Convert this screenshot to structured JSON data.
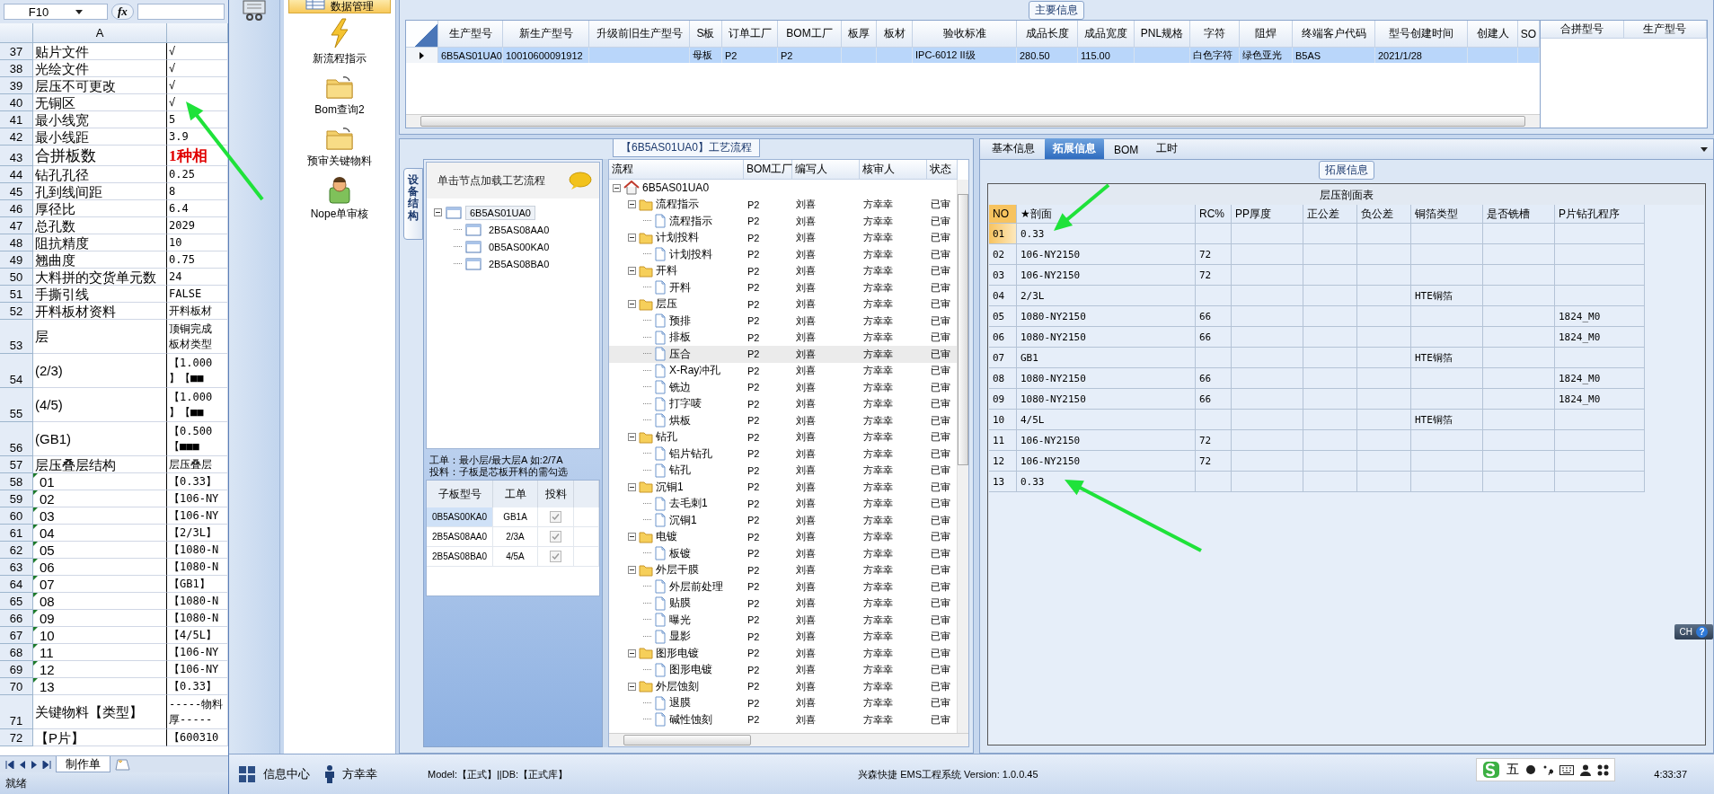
{
  "spreadsheet": {
    "name_box": "F10",
    "formula_label": "fx",
    "column_header": "A",
    "rows": [
      {
        "num": "37",
        "a": "贴片文件",
        "b": [
          "√"
        ]
      },
      {
        "num": "38",
        "a": "光绘文件",
        "b": [
          "√"
        ]
      },
      {
        "num": "39",
        "a": "层压不可更改",
        "b": [
          "√"
        ]
      },
      {
        "num": "40",
        "a": "无铜区",
        "b": [
          "√"
        ],
        "marked": true
      },
      {
        "num": "41",
        "a": "最小线宽",
        "b": [
          "5"
        ]
      },
      {
        "num": "42",
        "a": "最小线距",
        "b": [
          "3.9"
        ]
      },
      {
        "num": "43",
        "a": "合拼板数",
        "b": [
          "1种相"
        ],
        "kind": "emphasis"
      },
      {
        "num": "44",
        "a": "钻孔孔径",
        "b": [
          "0.25"
        ]
      },
      {
        "num": "45",
        "a": "孔到线间距",
        "b": [
          "8"
        ]
      },
      {
        "num": "46",
        "a": "厚径比",
        "b": [
          "6.4"
        ]
      },
      {
        "num": "47",
        "a": "总孔数",
        "b": [
          "2029"
        ]
      },
      {
        "num": "48",
        "a": "阻抗精度",
        "b": [
          "10"
        ]
      },
      {
        "num": "49",
        "a": "翘曲度",
        "b": [
          "0.75"
        ]
      },
      {
        "num": "50",
        "a": "大料拼的交货单元数",
        "b": [
          "24"
        ]
      },
      {
        "num": "51",
        "a": "手撕引线",
        "b": [
          "FALSE"
        ]
      },
      {
        "num": "52",
        "a": "开料板材资料",
        "b": [
          "开料板材"
        ]
      },
      {
        "num": "53",
        "a": "层",
        "b": [
          "顶铜完成",
          "板材类型"
        ]
      },
      {
        "num": "54",
        "a": "(2/3)",
        "b": [
          "【1.000",
          "】【■■"
        ]
      },
      {
        "num": "55",
        "a": "(4/5)",
        "b": [
          "【1.000",
          "】【■■"
        ]
      },
      {
        "num": "56",
        "a": "(GB1)",
        "b": [
          "【0.500",
          "【■■■"
        ]
      },
      {
        "num": "57",
        "a": "层压叠层结构",
        "b": [
          "层压叠层"
        ]
      },
      {
        "num": "58",
        "a": "01",
        "b": [
          "【0.33】"
        ],
        "flag": true
      },
      {
        "num": "59",
        "a": "02",
        "b": [
          "【106-NY"
        ],
        "flag": true
      },
      {
        "num": "60",
        "a": "03",
        "b": [
          "【106-NY"
        ],
        "flag": true
      },
      {
        "num": "61",
        "a": "04",
        "b": [
          "【2/3L】"
        ],
        "flag": true
      },
      {
        "num": "62",
        "a": "05",
        "b": [
          "【1080-N"
        ],
        "flag": true
      },
      {
        "num": "63",
        "a": "06",
        "b": [
          "【1080-N"
        ],
        "flag": true
      },
      {
        "num": "64",
        "a": "07",
        "b": [
          "【GB1】"
        ],
        "flag": true
      },
      {
        "num": "65",
        "a": "08",
        "b": [
          "【1080-N"
        ],
        "flag": true
      },
      {
        "num": "66",
        "a": "09",
        "b": [
          "【1080-N"
        ],
        "flag": true
      },
      {
        "num": "67",
        "a": "10",
        "b": [
          "【4/5L】"
        ],
        "flag": true
      },
      {
        "num": "68",
        "a": "11",
        "b": [
          "【106-NY"
        ],
        "flag": true
      },
      {
        "num": "69",
        "a": "12",
        "b": [
          "【106-NY"
        ],
        "flag": true
      },
      {
        "num": "70",
        "a": "13",
        "b": [
          "【0.33】"
        ],
        "flag": true
      },
      {
        "num": "71",
        "a": "关键物料【类型】",
        "b": [
          "-----物料",
          "厚-----"
        ]
      },
      {
        "num": "72",
        "a": "【P片】",
        "b": [
          "【600310"
        ]
      }
    ],
    "sheet_tabs": [
      {
        "label": "制作单",
        "selected": true
      }
    ],
    "status": "就绪"
  },
  "nav": {
    "items": [
      {
        "label": "数据管理",
        "kind": "table",
        "selected": true
      },
      {
        "label": "新流程指示",
        "kind": "lightning",
        "selected": false
      },
      {
        "label": "Bom查询2",
        "kind": "folder",
        "selected": false
      },
      {
        "label": "预审关键物料",
        "kind": "folder",
        "selected": false
      },
      {
        "label": "Nope单审核",
        "kind": "person",
        "selected": false
      }
    ]
  },
  "main_info": {
    "title": "主要信息",
    "columns": [
      "生产型号",
      "新生产型号",
      "升级前旧生产型号",
      "S板",
      "订单工厂",
      "BOM工厂",
      "板厚",
      "板材",
      "验收标准",
      "成品长度",
      "成品宽度",
      "PNL规格",
      "字符",
      "阻焊",
      "终端客户代码",
      "型号创建时间",
      "创建人",
      "SO"
    ],
    "rows": [
      {
        "current": true,
        "cells": [
          "6B5AS01UA0",
          "10010600091912",
          null,
          "母板",
          "P2",
          "P2",
          null,
          null,
          "IPC-6012 II级",
          "280.50",
          "115.00",
          null,
          "白色字符",
          "绿色亚光",
          "B5AS",
          "2021/1/28",
          null,
          null
        ]
      }
    ],
    "side_columns": [
      "合拼型号",
      "生产型号"
    ]
  },
  "process": {
    "title": "【6B5AS01UA0】工艺流程",
    "side_tab": "设备结构",
    "hint": "单击节点加载工艺流程",
    "structure_tree": [
      {
        "label": "6B5AS01UA0",
        "expanded": true,
        "selected": true,
        "children": [
          {
            "label": "2B5AS08AA0",
            "selected": false
          },
          {
            "label": "0B5AS00KA0",
            "selected": false
          },
          {
            "label": "2B5AS08BA0",
            "selected": false
          }
        ]
      }
    ],
    "notes": [
      "工单：最小层/最大层A 如:2/7A",
      "投料：子板是芯板开料的需勾选"
    ],
    "sub_boards": {
      "columns": [
        "子板型号",
        "工单",
        "投料"
      ],
      "rows": [
        {
          "cells": [
            "0B5AS00KA0",
            "GB1A"
          ],
          "checked": true,
          "selected": true
        },
        {
          "cells": [
            "2B5AS08AA0",
            "2/3A"
          ],
          "checked": true,
          "selected": false
        },
        {
          "cells": [
            "2B5AS08BA0",
            "4/5A"
          ],
          "checked": true,
          "selected": false
        }
      ]
    },
    "flow": {
      "columns": [
        "流程",
        "BOM工厂",
        "编写人",
        "核审人",
        "状态"
      ],
      "tree": [
        {
          "label": "6B5AS01UA0",
          "kind": "home",
          "expanded": true,
          "selected": false,
          "children": [
            {
              "label": "流程指示",
              "kind": "folder",
              "expanded": true,
              "selected": false,
              "cells": [
                "P2",
                "刘喜",
                "方幸幸",
                "已审"
              ],
              "children": [
                {
                  "label": "流程指示",
                  "kind": "file",
                  "selected": false,
                  "cells": [
                    "P2",
                    "刘喜",
                    "方幸幸",
                    "已审"
                  ]
                }
              ]
            },
            {
              "label": "计划投料",
              "kind": "folder",
              "expanded": true,
              "selected": false,
              "cells": [
                "P2",
                "刘喜",
                "方幸幸",
                "已审"
              ],
              "children": [
                {
                  "label": "计划投料",
                  "kind": "file",
                  "selected": false,
                  "cells": [
                    "P2",
                    "刘喜",
                    "方幸幸",
                    "已审"
                  ]
                }
              ]
            },
            {
              "label": "开料",
              "kind": "folder",
              "expanded": true,
              "selected": false,
              "cells": [
                "P2",
                "刘喜",
                "方幸幸",
                "已审"
              ],
              "children": [
                {
                  "label": "开料",
                  "kind": "file",
                  "selected": false,
                  "cells": [
                    "P2",
                    "刘喜",
                    "方幸幸",
                    "已审"
                  ]
                }
              ]
            },
            {
              "label": "层压",
              "kind": "folder",
              "expanded": true,
              "selected": false,
              "cells": [
                "P2",
                "刘喜",
                "方幸幸",
                "已审"
              ],
              "children": [
                {
                  "label": "预排",
                  "kind": "file",
                  "selected": false,
                  "cells": [
                    "P2",
                    "刘喜",
                    "方幸幸",
                    "已审"
                  ]
                },
                {
                  "label": "排板",
                  "kind": "file",
                  "selected": false,
                  "cells": [
                    "P2",
                    "刘喜",
                    "方幸幸",
                    "已审"
                  ]
                },
                {
                  "label": "压合",
                  "kind": "file",
                  "selected": true,
                  "cells": [
                    "P2",
                    "刘喜",
                    "方幸幸",
                    "已审"
                  ]
                },
                {
                  "label": "X-Ray冲孔",
                  "kind": "file",
                  "selected": false,
                  "cells": [
                    "P2",
                    "刘喜",
                    "方幸幸",
                    "已审"
                  ]
                },
                {
                  "label": "铣边",
                  "kind": "file",
                  "selected": false,
                  "cells": [
                    "P2",
                    "刘喜",
                    "方幸幸",
                    "已审"
                  ]
                },
                {
                  "label": "打字唛",
                  "kind": "file",
                  "selected": false,
                  "cells": [
                    "P2",
                    "刘喜",
                    "方幸幸",
                    "已审"
                  ]
                },
                {
                  "label": "烘板",
                  "kind": "file",
                  "selected": false,
                  "cells": [
                    "P2",
                    "刘喜",
                    "方幸幸",
                    "已审"
                  ]
                }
              ]
            },
            {
              "label": "钻孔",
              "kind": "folder",
              "expanded": true,
              "selected": false,
              "cells": [
                "P2",
                "刘喜",
                "方幸幸",
                "已审"
              ],
              "children": [
                {
                  "label": "铝片钻孔",
                  "kind": "file",
                  "selected": false,
                  "cells": [
                    "P2",
                    "刘喜",
                    "方幸幸",
                    "已审"
                  ]
                },
                {
                  "label": "钻孔",
                  "kind": "file",
                  "selected": false,
                  "cells": [
                    "P2",
                    "刘喜",
                    "方幸幸",
                    "已审"
                  ]
                }
              ]
            },
            {
              "label": "沉铜1",
              "kind": "folder",
              "expanded": true,
              "selected": false,
              "cells": [
                "P2",
                "刘喜",
                "方幸幸",
                "已审"
              ],
              "children": [
                {
                  "label": "去毛刺1",
                  "kind": "file",
                  "selected": false,
                  "cells": [
                    "P2",
                    "刘喜",
                    "方幸幸",
                    "已审"
                  ]
                },
                {
                  "label": "沉铜1",
                  "kind": "file",
                  "selected": false,
                  "cells": [
                    "P2",
                    "刘喜",
                    "方幸幸",
                    "已审"
                  ]
                }
              ]
            },
            {
              "label": "电镀",
              "kind": "folder",
              "expanded": true,
              "selected": false,
              "cells": [
                "P2",
                "刘喜",
                "方幸幸",
                "已审"
              ],
              "children": [
                {
                  "label": "板镀",
                  "kind": "file",
                  "selected": false,
                  "cells": [
                    "P2",
                    "刘喜",
                    "方幸幸",
                    "已审"
                  ]
                }
              ]
            },
            {
              "label": "外层干膜",
              "kind": "folder",
              "expanded": true,
              "selected": false,
              "cells": [
                "P2",
                "刘喜",
                "方幸幸",
                "已审"
              ],
              "children": [
                {
                  "label": "外层前处理",
                  "kind": "file",
                  "selected": false,
                  "cells": [
                    "P2",
                    "刘喜",
                    "方幸幸",
                    "已审"
                  ]
                },
                {
                  "label": "贴膜",
                  "kind": "file",
                  "selected": false,
                  "cells": [
                    "P2",
                    "刘喜",
                    "方幸幸",
                    "已审"
                  ]
                },
                {
                  "label": "曝光",
                  "kind": "file",
                  "selected": false,
                  "cells": [
                    "P2",
                    "刘喜",
                    "方幸幸",
                    "已审"
                  ]
                },
                {
                  "label": "显影",
                  "kind": "file",
                  "selected": false,
                  "cells": [
                    "P2",
                    "刘喜",
                    "方幸幸",
                    "已审"
                  ]
                }
              ]
            },
            {
              "label": "图形电镀",
              "kind": "folder",
              "expanded": true,
              "selected": false,
              "cells": [
                "P2",
                "刘喜",
                "方幸幸",
                "已审"
              ],
              "children": [
                {
                  "label": "图形电镀",
                  "kind": "file",
                  "selected": false,
                  "cells": [
                    "P2",
                    "刘喜",
                    "方幸幸",
                    "已审"
                  ]
                }
              ]
            },
            {
              "label": "外层蚀刻",
              "kind": "folder",
              "expanded": true,
              "selected": false,
              "cells": [
                "P2",
                "刘喜",
                "方幸幸",
                "已审"
              ],
              "children": [
                {
                  "label": "退膜",
                  "kind": "file",
                  "selected": false,
                  "cells": [
                    "P2",
                    "刘喜",
                    "方幸幸",
                    "已审"
                  ]
                },
                {
                  "label": "碱性蚀刻",
                  "kind": "file",
                  "selected": false,
                  "cells": [
                    "P2",
                    "刘喜",
                    "方幸幸",
                    "已审"
                  ]
                }
              ]
            }
          ]
        }
      ]
    }
  },
  "details": {
    "tabs": [
      {
        "label": "基本信息",
        "selected": false
      },
      {
        "label": "拓展信息",
        "selected": true
      },
      {
        "label": "BOM",
        "selected": false
      },
      {
        "label": "工时",
        "selected": false
      }
    ],
    "group_title": "拓展信息",
    "table": {
      "title": "层压剖面表",
      "columns": [
        "NO",
        "★剖面",
        "RC%",
        "PP厚度",
        "正公差",
        "负公差",
        "铜箔类型",
        "是否铣槽",
        "P片钻孔程序"
      ],
      "rows": [
        {
          "selected": true,
          "marked": true,
          "cells": [
            "01",
            "0.33",
            null,
            null,
            null,
            null,
            null,
            null,
            null
          ]
        },
        {
          "selected": false,
          "cells": [
            "02",
            "106-NY2150",
            "72",
            null,
            null,
            null,
            null,
            null,
            null
          ]
        },
        {
          "selected": false,
          "cells": [
            "03",
            "106-NY2150",
            "72",
            null,
            null,
            null,
            null,
            null,
            null
          ]
        },
        {
          "selected": false,
          "cells": [
            "04",
            "2/3L",
            null,
            null,
            null,
            null,
            "HTE铜箔",
            null,
            null
          ]
        },
        {
          "selected": false,
          "cells": [
            "05",
            "1080-NY2150",
            "66",
            null,
            null,
            null,
            null,
            null,
            "1824_M0"
          ]
        },
        {
          "selected": false,
          "cells": [
            "06",
            "1080-NY2150",
            "66",
            null,
            null,
            null,
            null,
            null,
            "1824_M0"
          ]
        },
        {
          "selected": false,
          "cells": [
            "07",
            "GB1",
            null,
            null,
            null,
            null,
            "HTE铜箔",
            null,
            null
          ]
        },
        {
          "selected": false,
          "cells": [
            "08",
            "1080-NY2150",
            "66",
            null,
            null,
            null,
            null,
            null,
            "1824_M0"
          ]
        },
        {
          "selected": false,
          "cells": [
            "09",
            "1080-NY2150",
            "66",
            null,
            null,
            null,
            null,
            null,
            "1824_M0"
          ]
        },
        {
          "selected": false,
          "cells": [
            "10",
            "4/5L",
            null,
            null,
            null,
            null,
            "HTE铜箔",
            null,
            null
          ]
        },
        {
          "selected": false,
          "cells": [
            "11",
            "106-NY2150",
            "72",
            null,
            null,
            null,
            null,
            null,
            null
          ]
        },
        {
          "selected": false,
          "cells": [
            "12",
            "106-NY2150",
            "72",
            null,
            null,
            null,
            null,
            null,
            null
          ]
        },
        {
          "selected": false,
          "marked": true,
          "cells": [
            "13",
            "0.33",
            null,
            null,
            null,
            null,
            null,
            null,
            null
          ]
        }
      ]
    }
  },
  "language_bar": {
    "label": "CH",
    "help": "?"
  },
  "status_bar": {
    "items": [
      {
        "label": "信息中心",
        "kind": "grid"
      },
      {
        "label": "方幸幸",
        "kind": "person"
      }
    ],
    "model": "Model:【正式】||DB:【正式库】",
    "product": "兴森快捷 EMS工程系统 Version: 1.0.0.45",
    "clock": "4:33:37"
  },
  "ime_bar": {
    "mode": "五"
  }
}
